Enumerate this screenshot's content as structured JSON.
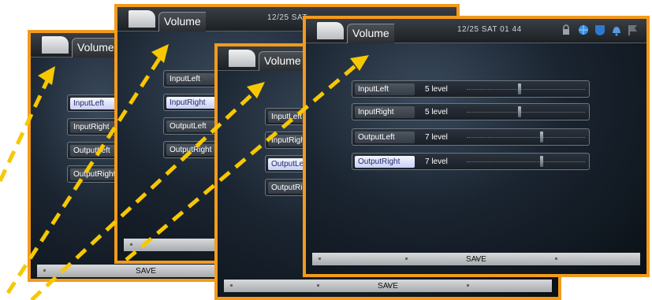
{
  "screens": [
    {
      "title": "Volume",
      "rows": [
        "InputLeft",
        "InputRight",
        "OutputLeft",
        "OutputRight"
      ],
      "highlighted_row": 0,
      "save_label": "SAVE"
    },
    {
      "title": "Volume",
      "datetime": "12/25 SAT",
      "rows": [
        "InputLeft",
        "InputRight",
        "OutputLeft",
        "OutputRight"
      ],
      "highlighted_row": 1
    },
    {
      "title": "Volume",
      "rows": [
        "InputLeft",
        "InputRight",
        "OutputLeft",
        "OutputRight"
      ],
      "highlighted_row": 2,
      "save_label": "SAVE"
    },
    {
      "title": "Volume",
      "datetime": "12/25 SAT 01 44",
      "status_icons": [
        "lock-icon",
        "globe-icon",
        "shield-icon",
        "bell-icon",
        "flag-icon"
      ],
      "rows": [
        {
          "name": "InputLeft",
          "level": "5 level",
          "value": 5
        },
        {
          "name": "InputRight",
          "level": "5 level",
          "value": 5
        },
        {
          "name": "OutputLeft",
          "level": "7 level",
          "value": 7
        },
        {
          "name": "OutputRight",
          "level": "7 level",
          "value": 7
        }
      ],
      "highlighted_row": 3,
      "save_label": "SAVE"
    }
  ],
  "annotation_color": "#f7c800",
  "frame_color": "#f39a1c"
}
